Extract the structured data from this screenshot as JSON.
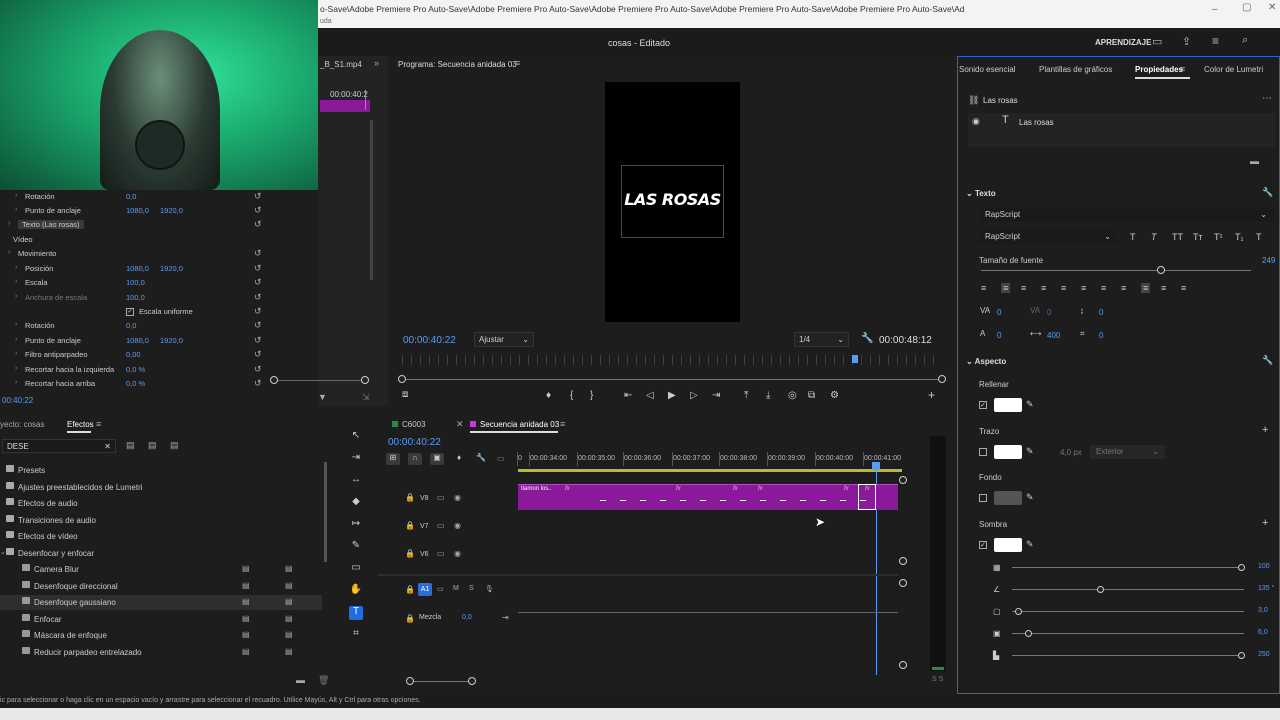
{
  "window": {
    "title_path": "o-Save\\Adobe Premiere Pro Auto-Save\\Adobe Premiere Pro Auto-Save\\Adobe Premiere Pro Auto-Save\\Adobe Premiere Pro Auto-Save\\Adobe Premiere Pro Auto-Save\\Ad",
    "subline": "uda",
    "project_title": "cosas - Editado",
    "workspace": "APRENDIZAJE"
  },
  "source": {
    "clip_name": "_B_S1.mp4",
    "timecode": "00:00:40:2"
  },
  "effect_controls": {
    "rows": [
      {
        "label": "Rotación",
        "v1": "0,0",
        "v2": ""
      },
      {
        "label": "Punto de anclaje",
        "v1": "1080,0",
        "v2": "1920,0"
      },
      {
        "label": "Texto (Las rosas)",
        "v1": "",
        "v2": ""
      },
      {
        "label": "Vídeo",
        "v1": "",
        "v2": ""
      },
      {
        "label": "Movimiento",
        "v1": "",
        "v2": ""
      },
      {
        "label": "Posición",
        "v1": "1080,0",
        "v2": "1920,0"
      },
      {
        "label": "Escala",
        "v1": "100,0",
        "v2": ""
      },
      {
        "label": "Anchura de escala",
        "v1": "100,0",
        "v2": ""
      },
      {
        "label": "Escala uniforme",
        "v1": "",
        "v2": ""
      },
      {
        "label": "Rotación",
        "v1": "0,0",
        "v2": ""
      },
      {
        "label": "Punto de anclaje",
        "v1": "1080,0",
        "v2": "1920,0"
      },
      {
        "label": "Filtro antiparpadeo",
        "v1": "0,00",
        "v2": ""
      },
      {
        "label": "Recortar hacia la izquierda",
        "v1": "0,0 %",
        "v2": ""
      },
      {
        "label": "Recortar hacia arriba",
        "v1": "0,0 %",
        "v2": ""
      }
    ],
    "timecode": "00:40:22"
  },
  "program": {
    "title": "Programa: Secuencia anidada 03",
    "overlay_text": "LAS ROSAS",
    "timecode": "00:00:40:22",
    "fit": "Ajustar",
    "resolution": "1/4",
    "duration": "00:00:48:12"
  },
  "right_tabs": [
    "Sonido esencial",
    "Plantillas de gráficos",
    "Propiedades",
    "Color de Lumetri"
  ],
  "properties": {
    "layer_group": "Las rosas",
    "layer_item": "Las rosas",
    "section_text": "Texto",
    "font_family": "RapScript",
    "font_style": "RapScript",
    "font_size_label": "Tamaño de fuente",
    "font_size": "249",
    "tracking": [
      "0",
      "0"
    ],
    "kerning": [
      "0",
      "400"
    ],
    "baseline": [
      "0",
      "0"
    ],
    "section_appearance": "Aspecto",
    "fill_label": "Rellenar",
    "stroke_label": "Trazo",
    "stroke_width": "4,0",
    "stroke_unit": "px",
    "stroke_pos": "Exterior",
    "bg_label": "Fondo",
    "shadow_label": "Sombra",
    "shadow_values": {
      "opacity": "100",
      "angle": "135 °",
      "distance": "3,0",
      "size": "6,0",
      "blur": "250"
    },
    "colors": {
      "accent": "#5b9cf4",
      "fill": "#ffffff"
    }
  },
  "project": {
    "tabs": [
      "yecto: cosas",
      "Efectos"
    ],
    "search": "DESE",
    "tree": [
      {
        "label": "Presets",
        "level": 0
      },
      {
        "label": "Ajustes preestablecidos de Lumetri",
        "level": 0
      },
      {
        "label": "Efectos de audio",
        "level": 0
      },
      {
        "label": "Transiciones de audio",
        "level": 0
      },
      {
        "label": "Efectos de vídeo",
        "level": 0
      },
      {
        "label": "Desenfocar y enfocar",
        "level": 0
      },
      {
        "label": "Camera Blur",
        "level": 1
      },
      {
        "label": "Desenfoque direccional",
        "level": 1
      },
      {
        "label": "Desenfoque gaussiano",
        "level": 1
      },
      {
        "label": "Enfocar",
        "level": 1
      },
      {
        "label": "Máscara de enfoque",
        "level": 1
      },
      {
        "label": "Reducir parpadeo entrelazado",
        "level": 1
      }
    ]
  },
  "timeline": {
    "tabs": [
      "C6003",
      "Secuencia anidada 03"
    ],
    "timecode": "00:00:40:22",
    "ruler": [
      "0",
      "00:00:34:00",
      "00:00:35:00",
      "00:00:36:00",
      "00:00:37:00",
      "00:00:38:00",
      "00:00:39:00",
      "00:00:40:00",
      "00:00:41:00"
    ],
    "tracks": [
      "V8",
      "V7",
      "V6",
      "A1",
      "Mezcla"
    ],
    "mix_value": "0,0",
    "clip_label": "tlamon los..",
    "fx_label": "fx"
  },
  "status": {
    "hint": "ic para seleccionar o haga clic en un espacio vacío y arrastre para seleccionar el recuadro. Utilice Mayús, Alt y Ctrl para otras opciones."
  },
  "audio_meter": {
    "labels": "S S"
  }
}
